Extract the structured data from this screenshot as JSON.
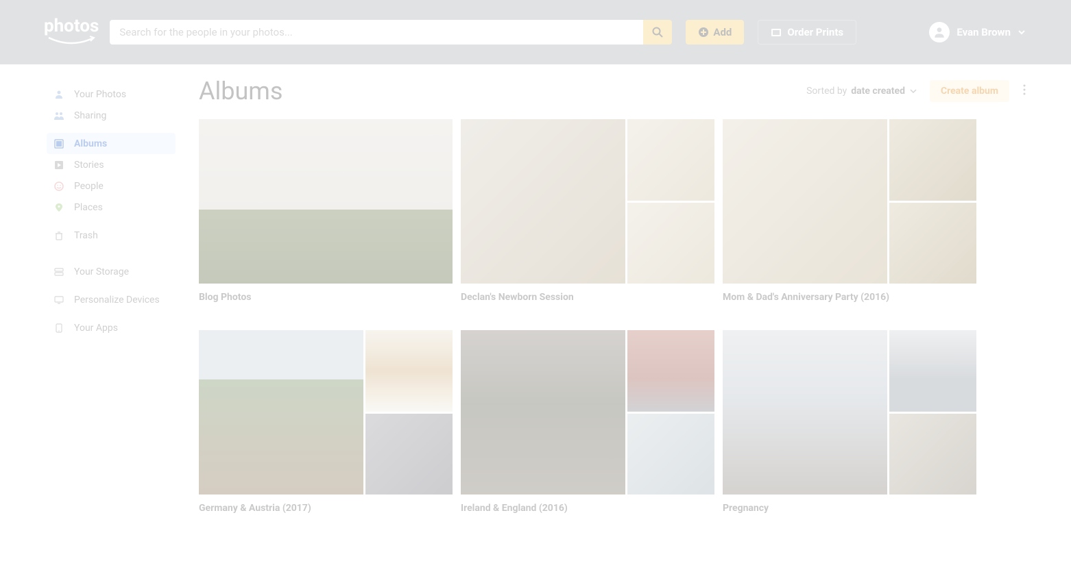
{
  "header": {
    "logo_text": "photos",
    "search_placeholder": "Search for the people in your photos...",
    "add_label": "Add",
    "order_prints_label": "Order Prints",
    "user_name": "Evan Brown"
  },
  "sidebar": {
    "items": [
      {
        "label": "Your Photos",
        "icon": "person",
        "active": false
      },
      {
        "label": "Sharing",
        "icon": "people",
        "active": false
      },
      {
        "label": "Albums",
        "icon": "album",
        "active": true
      },
      {
        "label": "Stories",
        "icon": "play",
        "active": false
      },
      {
        "label": "People",
        "icon": "smile",
        "active": false
      },
      {
        "label": "Places",
        "icon": "pin",
        "active": false
      },
      {
        "label": "Trash",
        "icon": "trash",
        "active": false
      },
      {
        "label": "Your Storage",
        "icon": "storage",
        "active": false
      },
      {
        "label": "Personalize Devices",
        "icon": "devices",
        "active": false
      },
      {
        "label": "Your Apps",
        "icon": "apps",
        "active": false
      }
    ]
  },
  "main": {
    "title": "Albums",
    "sort_prefix": "Sorted by ",
    "sort_value": "date created",
    "create_label": "Create album",
    "albums": [
      {
        "title": "Blog Photos",
        "layout": "single"
      },
      {
        "title": "Declan's Newborn Session",
        "layout": "triple"
      },
      {
        "title": "Mom & Dad's Anniversary Party (2016)",
        "layout": "triple"
      },
      {
        "title": "Germany & Austria (2017)",
        "layout": "triple"
      },
      {
        "title": "Ireland & England (2016)",
        "layout": "triple"
      },
      {
        "title": "Pregnancy",
        "layout": "triple"
      }
    ]
  }
}
